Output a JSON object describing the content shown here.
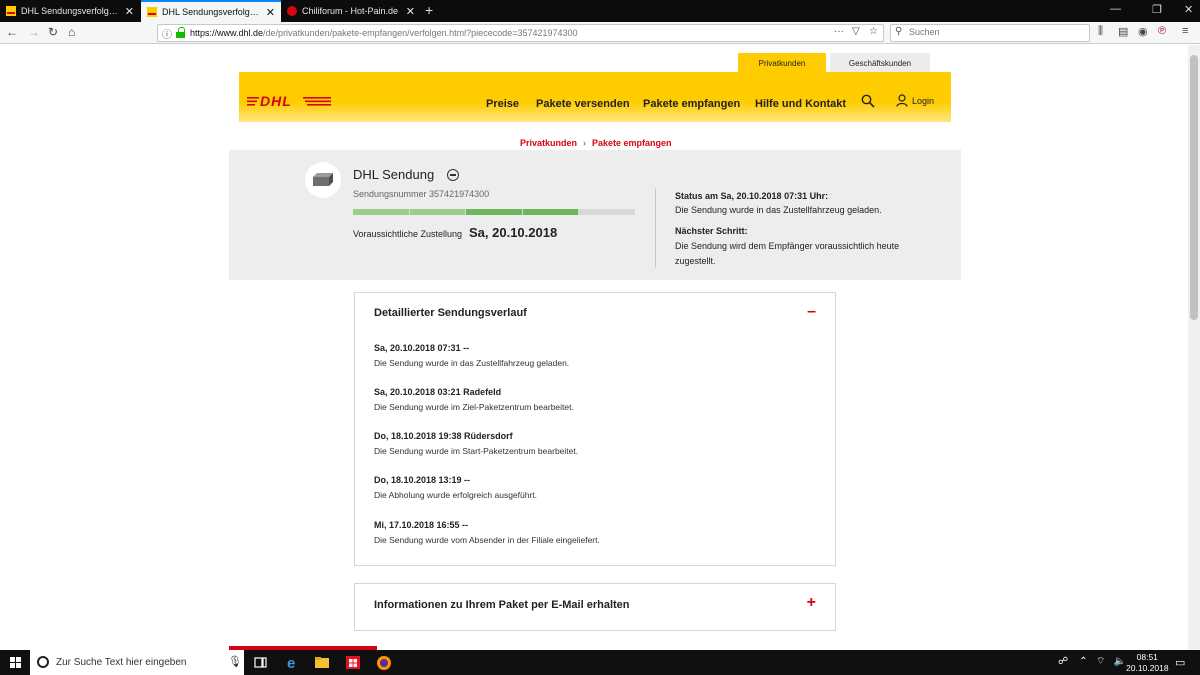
{
  "browser": {
    "tabs": [
      {
        "title": "DHL Sendungsverfolgung - de",
        "active": false
      },
      {
        "title": "DHL Sendungsverfolgung",
        "active": true
      },
      {
        "title": "Chiliforum - Hot-Pain.de",
        "active": false
      }
    ],
    "url_host": "https://www.dhl.de",
    "url_path": "/de/privatkunden/pakete-empfangen/verfolgen.html?piececode=357421974300",
    "search_placeholder": "Suchen",
    "accent": "#0a84ff"
  },
  "site": {
    "segments": {
      "private": "Privatkunden",
      "business": "Geschäftskunden"
    },
    "brand_yellow": "#ffcc00",
    "brand_red": "#d40511",
    "logo_text": "DHL",
    "nav": [
      "Preise",
      "Pakete versenden",
      "Pakete empfangen",
      "Hilfe und Kontakt"
    ],
    "login_label": "Login"
  },
  "breadcrumb": [
    "Privatkunden",
    "Pakete empfangen"
  ],
  "summary": {
    "title": "DHL Sendung",
    "tracking_number": "Sendungsnummer 357421974300",
    "progress_steps_total": 5,
    "progress_steps_done": 4,
    "eta_label": "Voraussichtliche Zustellung",
    "eta_value": "Sa, 20.10.2018",
    "status_heading": "Status am Sa, 20.10.2018 07:31 Uhr:",
    "status_text": "Die Sendung wurde in das Zustellfahrzeug geladen.",
    "next_heading": "Nächster Schritt:",
    "next_text": "Die Sendung wird dem Empfänger voraussichtlich heute zugestellt."
  },
  "history": {
    "title": "Detaillierter Sendungsverlauf",
    "toggle": "–",
    "events": [
      {
        "date": "Sa, 20.10.2018 07:31 --",
        "text": "Die Sendung wurde in das Zustellfahrzeug geladen."
      },
      {
        "date": "Sa, 20.10.2018 03:21 Radefeld",
        "text": "Die Sendung wurde im Ziel-Paketzentrum bearbeitet."
      },
      {
        "date": "Do, 18.10.2018 19:38 Rüdersdorf",
        "text": "Die Sendung wurde im Start-Paketzentrum bearbeitet."
      },
      {
        "date": "Do, 18.10.2018 13:19 --",
        "text": "Die Abholung wurde erfolgreich ausgeführt."
      },
      {
        "date": "Mi, 17.10.2018 16:55 --",
        "text": "Die Sendung wurde vom Absender in der Filiale eingeliefert."
      }
    ]
  },
  "mail_panel": {
    "title": "Informationen zu Ihrem Paket per E-Mail erhalten",
    "toggle": "+"
  },
  "taskbar": {
    "search_placeholder": "Zur Suche Text hier eingeben",
    "time": "08:51",
    "date": "20.10.2018"
  }
}
